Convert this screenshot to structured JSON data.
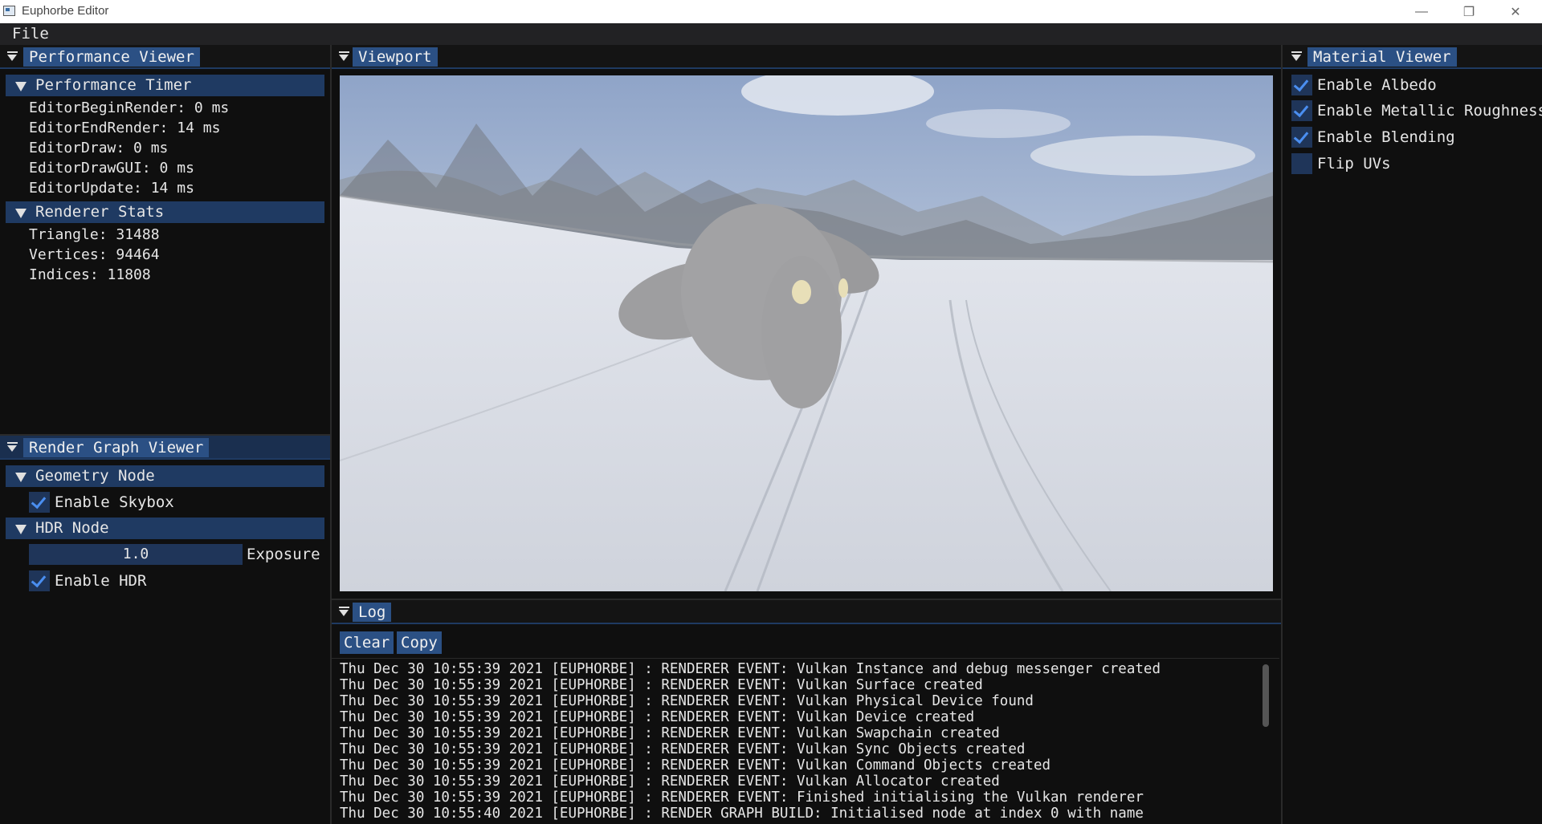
{
  "window": {
    "title": "Euphorbe Editor"
  },
  "menu": {
    "file": "File"
  },
  "performance_viewer": {
    "tab": "Performance Viewer",
    "timer_section": "Performance Timer",
    "timers": [
      "EditorBeginRender: 0 ms",
      "EditorEndRender: 14 ms",
      "EditorDraw: 0 ms",
      "EditorDrawGUI: 0 ms",
      "EditorUpdate: 14 ms"
    ],
    "stats_section": "Renderer Stats",
    "stats": [
      "Triangle: 31488",
      "Vertices: 94464",
      "Indices: 11808"
    ]
  },
  "render_graph_viewer": {
    "tab": "Render Graph Viewer",
    "geometry_section": "Geometry Node",
    "enable_skybox": "Enable Skybox",
    "hdr_section": "HDR Node",
    "exposure_value": "1.0",
    "exposure_label": "Exposure",
    "enable_hdr": "Enable HDR"
  },
  "viewport": {
    "tab": "Viewport"
  },
  "material_viewer": {
    "tab": "Material Viewer",
    "options": [
      {
        "label": "Enable Albedo",
        "checked": true
      },
      {
        "label": "Enable Metallic Roughness",
        "checked": true
      },
      {
        "label": "Enable Blending",
        "checked": true
      },
      {
        "label": "Flip UVs",
        "checked": false
      }
    ]
  },
  "log": {
    "tab": "Log",
    "clear": "Clear",
    "copy": "Copy",
    "lines": [
      "Thu Dec 30 10:55:39 2021 [EUPHORBE] : RENDERER EVENT: Vulkan Instance and debug messenger created",
      "Thu Dec 30 10:55:39 2021 [EUPHORBE] : RENDERER EVENT: Vulkan Surface created",
      "Thu Dec 30 10:55:39 2021 [EUPHORBE] : RENDERER EVENT: Vulkan Physical Device found",
      "Thu Dec 30 10:55:39 2021 [EUPHORBE] : RENDERER EVENT: Vulkan Device created",
      "Thu Dec 30 10:55:39 2021 [EUPHORBE] : RENDERER EVENT: Vulkan Swapchain created",
      "Thu Dec 30 10:55:39 2021 [EUPHORBE] : RENDERER EVENT: Vulkan Sync Objects created",
      "Thu Dec 30 10:55:39 2021 [EUPHORBE] : RENDERER EVENT: Vulkan Command Objects created",
      "Thu Dec 30 10:55:39 2021 [EUPHORBE] : RENDERER EVENT: Vulkan Allocator created",
      "Thu Dec 30 10:55:39 2021 [EUPHORBE] : RENDERER EVENT: Finished initialising the Vulkan renderer",
      "Thu Dec 30 10:55:40 2021 [EUPHORBE] : RENDER GRAPH BUILD: Initialised node at index 0 with name"
    ]
  },
  "colors": {
    "accent": "#2b5084",
    "header": "#1f3a62",
    "checkbox": "#1f3559",
    "check": "#4a8ef0",
    "background": "#0f0f0f"
  }
}
